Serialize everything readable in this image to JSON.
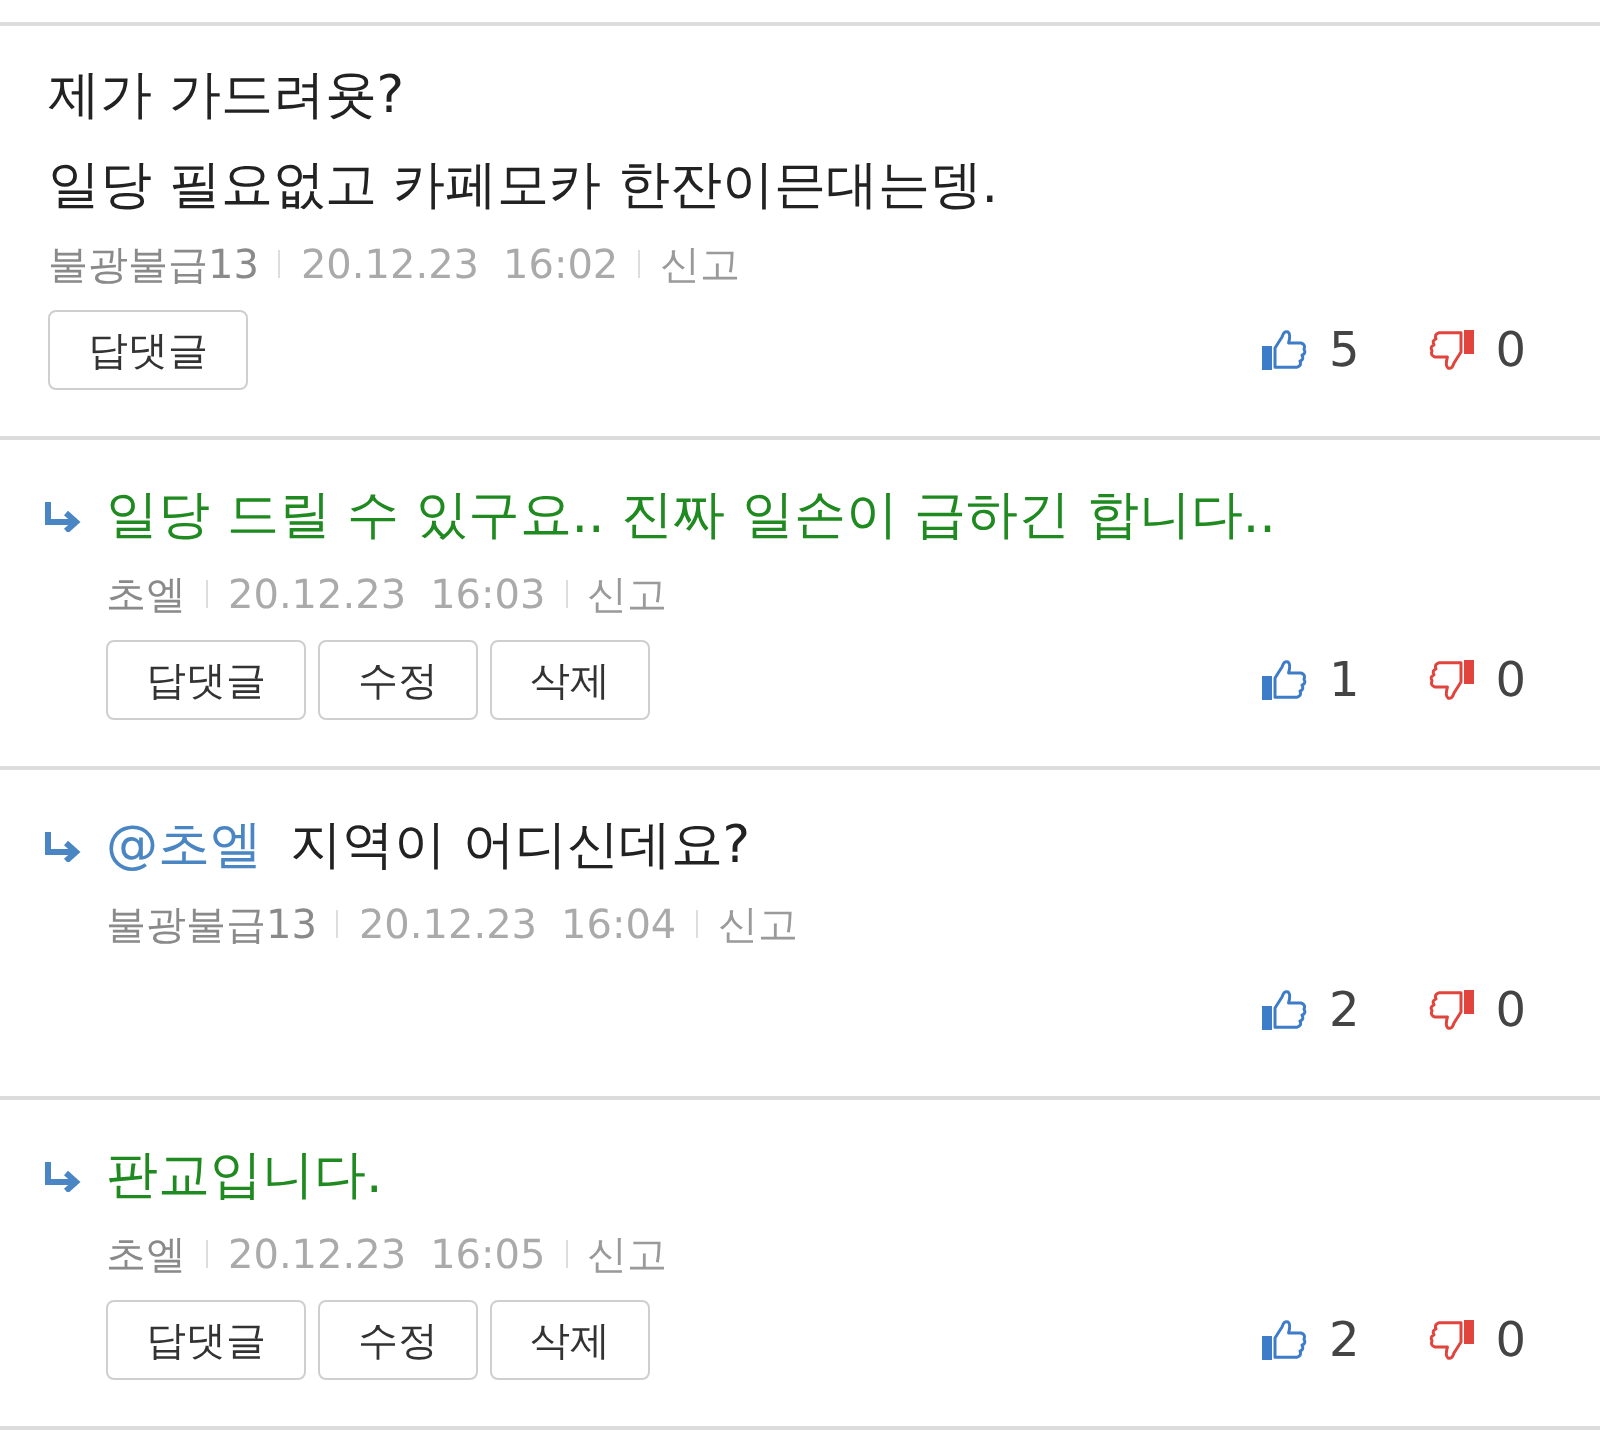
{
  "comments": [
    {
      "kind": "comment",
      "by_post_author": false,
      "text": "제가 가드려욧?\n일당 필요없고 카페모카 한잔이믄대는뎅.",
      "author": "불광불급13",
      "date": "20.12.23",
      "time": "16:02",
      "report": "신고",
      "buttons": [
        "답댓글"
      ],
      "likes": "5",
      "dislikes": "0"
    },
    {
      "kind": "reply",
      "by_post_author": true,
      "text": "일당 드릴 수 있구요.. 진짜 일손이 급하긴 합니다..",
      "author": "초엘",
      "date": "20.12.23",
      "time": "16:03",
      "report": "신고",
      "buttons": [
        "답댓글",
        "수정",
        "삭제"
      ],
      "likes": "1",
      "dislikes": "0"
    },
    {
      "kind": "reply",
      "by_post_author": false,
      "mention": "@초엘",
      "text": "지역이 어디신데요?",
      "author": "불광불급13",
      "date": "20.12.23",
      "time": "16:04",
      "report": "신고",
      "likes": "2",
      "dislikes": "0"
    },
    {
      "kind": "reply",
      "by_post_author": true,
      "text": "판교입니다.",
      "author": "초엘",
      "date": "20.12.23",
      "time": "16:05",
      "report": "신고",
      "buttons": [
        "답댓글",
        "수정",
        "삭제"
      ],
      "likes": "2",
      "dislikes": "0"
    }
  ]
}
